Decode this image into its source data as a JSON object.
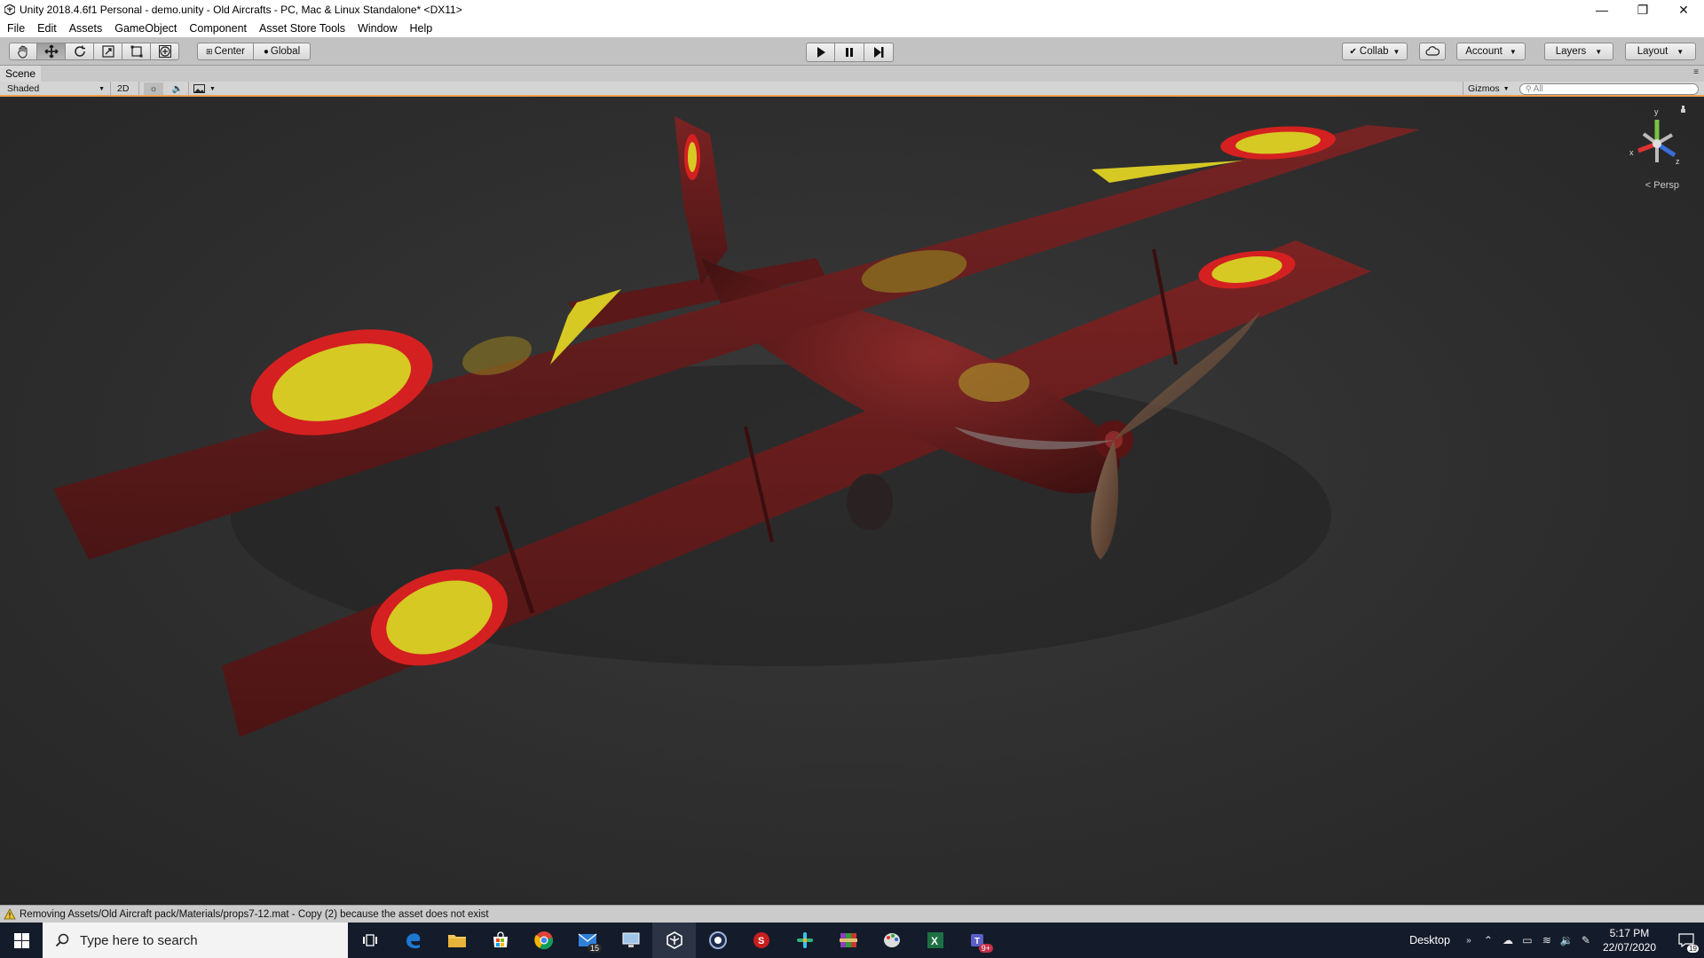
{
  "window": {
    "title": "Unity 2018.4.6f1 Personal - demo.unity - Old Aircrafts - PC, Mac & Linux Standalone* <DX11>",
    "minimize": "—",
    "maximize": "❐",
    "close": "✕"
  },
  "menu": {
    "items": [
      "File",
      "Edit",
      "Assets",
      "GameObject",
      "Component",
      "Asset Store Tools",
      "Window",
      "Help"
    ]
  },
  "toolbar": {
    "pivot_label": "Center",
    "space_label": "Global",
    "collab_label": "Collab",
    "account_label": "Account",
    "layers_label": "Layers",
    "layout_label": "Layout"
  },
  "scene": {
    "tab_label": "Scene",
    "draw_mode": "Shaded",
    "mode_2d": "2D",
    "gizmos_label": "Gizmos",
    "search_placeholder": "All",
    "projection_label": "Persp",
    "axis_y": "y",
    "axis_x": "x",
    "axis_z": "z"
  },
  "status": {
    "message": "Removing Assets/Old Aircraft pack/Materials/props7-12.mat - Copy (2) because the asset does not exist"
  },
  "taskbar": {
    "search_placeholder": "Type here to search",
    "mail_badge": "15",
    "teams_badge": "9+",
    "desktop_label": "Desktop",
    "time": "5:17 PM",
    "date": "22/07/2020",
    "notification_count": "19"
  },
  "colors": {
    "plane_body": "#6b1f1f",
    "roundel_outer": "#d42020",
    "roundel_inner": "#d6c924",
    "toolbar_bg": "#c2c2c2",
    "taskbar_bg": "#141b2a",
    "scene_accent": "#f0a050"
  }
}
